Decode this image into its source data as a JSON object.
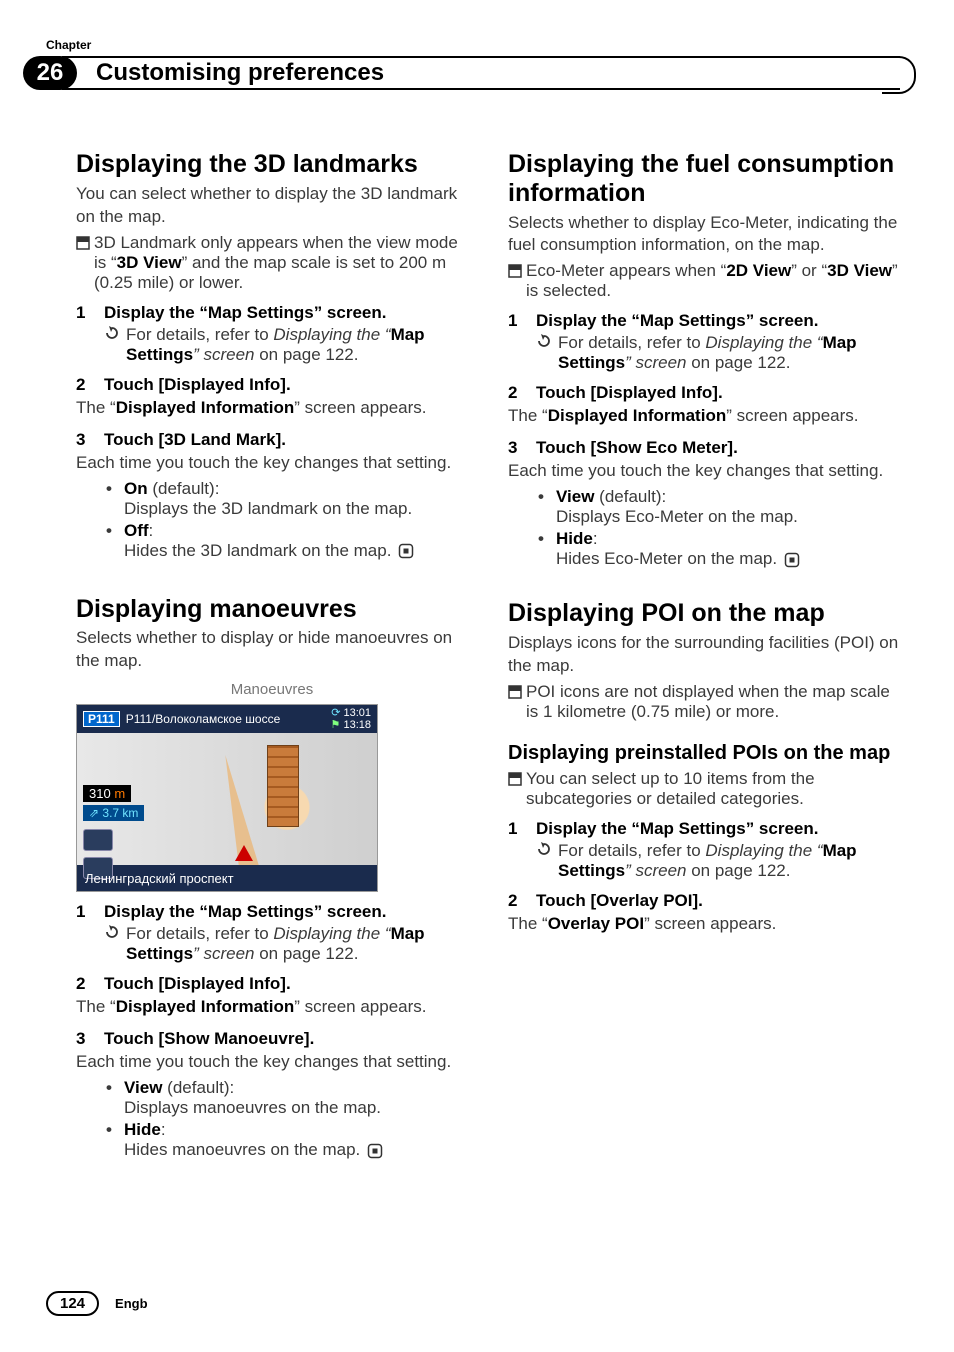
{
  "chapter_label": "Chapter",
  "chapter_number": "26",
  "chapter_title": "Customising preferences",
  "page_number": "124",
  "lang": "Engb",
  "landmarks": {
    "h": "Displaying the 3D landmarks",
    "intro": "You can select whether to display the 3D landmark on the map.",
    "note": "3D Landmark only appears when the view mode is “",
    "note_b": "3D View",
    "note_tail": "” and the map scale is set to 200 m (0.25 mile) or lower.",
    "s1": "Display the “Map Settings” screen.",
    "ref_a": "For details, refer to ",
    "ref_i": "Displaying the “",
    "ref_b": "Map Settings",
    "ref_i2": "” screen",
    "ref_tail": " on page 122.",
    "s2": "Touch [Displayed Info].",
    "s2_after_a": "The “",
    "s2_after_b": "Displayed Information",
    "s2_after_c": "” screen appears.",
    "s3": "Touch [3D Land Mark].",
    "s3_after": "Each time you touch the key changes that setting.",
    "opt_on": "On",
    "opt_on_tail": " (default):",
    "opt_on_desc": "Displays the 3D landmark on the map.",
    "opt_off": "Off",
    "opt_off_tail": ":",
    "opt_off_desc": "Hides the 3D landmark on the map."
  },
  "manoeuvres": {
    "h": "Displaying manoeuvres",
    "intro": "Selects whether to display or hide manoeuvres on the map.",
    "fig_caption": "Manoeuvres",
    "fig": {
      "route_no": "P111",
      "road_top": "Р111/Волоколамское шоссе",
      "clock1": "13:01",
      "clock2": "13:18",
      "dist_val": "310",
      "dist_unit": " m",
      "eta": "3.7 km",
      "road_bottom": "Ленинградский проспект"
    },
    "s1": "Display the “Map Settings” screen.",
    "s2": "Touch [Displayed Info].",
    "s3": "Touch [Show Manoeuvre].",
    "s3_after": "Each time you touch the key changes that setting.",
    "opt_view": "View",
    "opt_view_tail": " (default):",
    "opt_view_desc": "Displays manoeuvres on the map.",
    "opt_hide": "Hide",
    "opt_hide_tail": ":",
    "opt_hide_desc": "Hides manoeuvres on the map."
  },
  "fuel": {
    "h": "Displaying the fuel consumption information",
    "intro": "Selects whether to display Eco-Meter, indicating the fuel consumption information, on the map.",
    "note_a": "Eco-Meter appears when “",
    "note_b1": "2D View",
    "note_mid": "” or “",
    "note_b2": "3D View",
    "note_tail": "” is selected.",
    "s1": "Display the “Map Settings” screen.",
    "s2": "Touch [Displayed Info].",
    "s3": "Touch [Show Eco Meter].",
    "s3_after": "Each time you touch the key changes that setting.",
    "opt_view": "View",
    "opt_view_tail": " (default):",
    "opt_view_desc": "Displays Eco-Meter on the map.",
    "opt_hide": "Hide",
    "opt_hide_tail": ":",
    "opt_hide_desc": "Hides Eco-Meter on the map."
  },
  "poi": {
    "h": "Displaying POI on the map",
    "intro": "Displays icons for the surrounding facilities (POI) on the map.",
    "note": "POI icons are not displayed when the map scale is 1 kilometre (0.75 mile) or more.",
    "sub_h": "Displaying preinstalled POIs on the map",
    "sub_note": "You can select up to 10 items from the subcategories or detailed categories.",
    "s1": "Display the “Map Settings” screen.",
    "s2": "Touch [Overlay POI].",
    "s2_after_a": "The “",
    "s2_after_b": "Overlay POI",
    "s2_after_c": "” screen appears."
  }
}
